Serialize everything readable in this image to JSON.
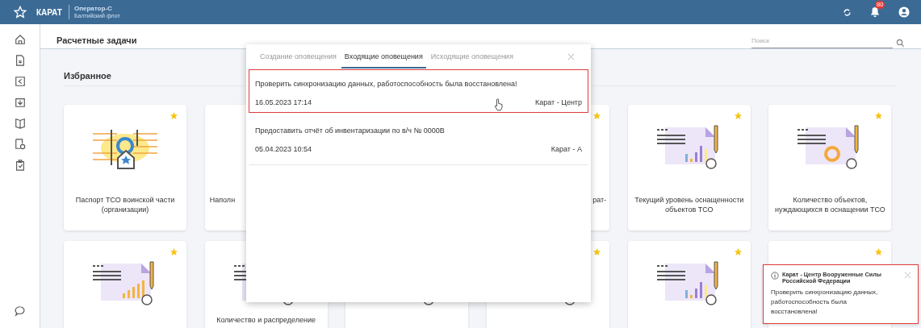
{
  "header": {
    "logo": "КАРАТ",
    "operator": "Оператор-С",
    "fleet": "Балтийский флот",
    "badge": "80"
  },
  "page": {
    "title": "Расчетные задачи",
    "search": {
      "placeholder": "Поиск"
    },
    "section": "Избранное"
  },
  "rows": [
    {
      "cards": [
        {
          "label": "Паспорт ТСО воинской части (организации)",
          "starred": true,
          "kind": "passport"
        },
        {
          "label": "Наполн",
          "kind": "plus"
        },
        {
          "kind": "hidden"
        },
        {
          "label": "рат-",
          "starred": true,
          "kind": "covered"
        },
        {
          "label": "Текущий уровень оснащенности объектов ТСО",
          "starred": true,
          "kind": "bars"
        },
        {
          "label": "Количество объектов, нуждающихся в оснащении ТСО",
          "starred": true,
          "kind": "donut"
        }
      ]
    },
    {
      "cards": [
        {
          "starred": true,
          "kind": "orange"
        },
        {
          "label": "Количество и распределение",
          "kind": "table"
        },
        {
          "kind": "low"
        },
        {
          "starred": true,
          "kind": "low"
        },
        {
          "starred": true,
          "kind": "bars"
        },
        {
          "starred": true,
          "kind": "covered"
        }
      ]
    }
  ],
  "popup": {
    "tabs": [
      {
        "label": "Создание оповещения",
        "selected": false
      },
      {
        "label": "Входящие оповещения",
        "selected": true
      },
      {
        "label": "Исходящие оповещения",
        "selected": false
      }
    ],
    "items": [
      {
        "text": "Проверить синхронизацию данных, работоспособность была восстановлена!",
        "date": "16.05.2023  17:14",
        "sender": "Карат - Центр",
        "highlighted": true
      },
      {
        "text": "Предоставить отчёт об инвентаризации по в/ч № 0000В",
        "date": "05.04.2023  10:54",
        "sender": "Карат - А",
        "highlighted": false
      }
    ]
  },
  "toast": {
    "title": "Карат - Центр Вооруженные Силы Российской Федерации",
    "text": "Проверить синхронизацию данных, работоспособность была восстановлена!",
    "highlighted": true
  }
}
